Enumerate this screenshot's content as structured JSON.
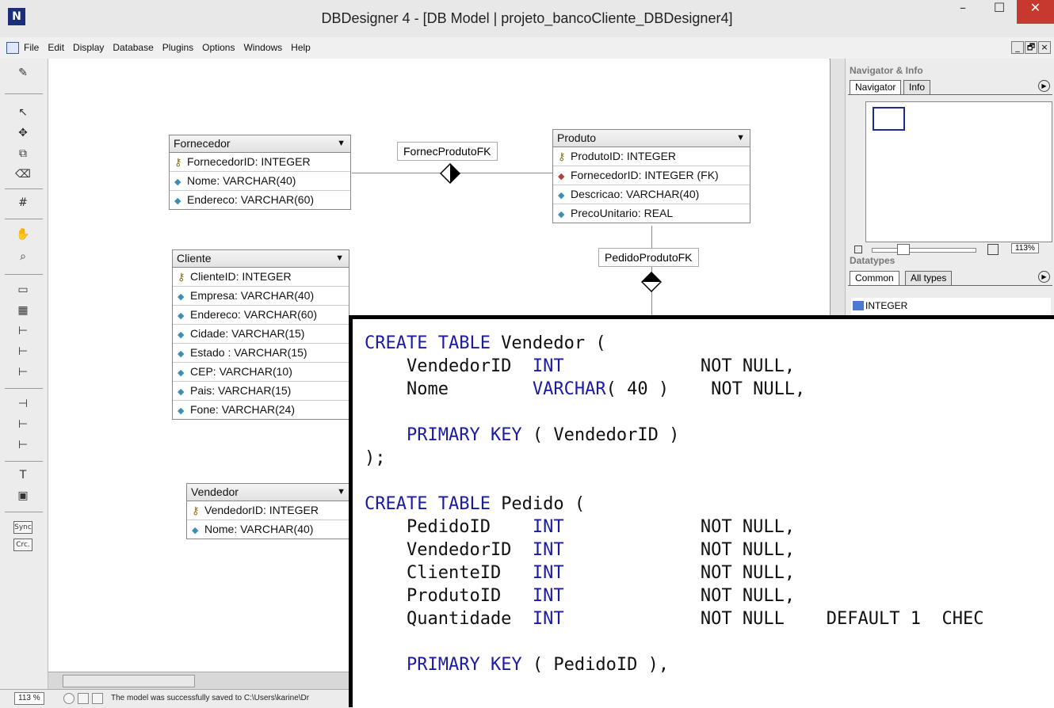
{
  "window": {
    "title": "DBDesigner 4 - [DB Model | projeto_bancoCliente_DBDesigner4]",
    "minimize": "–",
    "maximize": "☐",
    "close": "✕"
  },
  "menu": {
    "items": [
      "File",
      "Edit",
      "Display",
      "Database",
      "Plugins",
      "Options",
      "Windows",
      "Help"
    ],
    "mdi_buttons": [
      "_",
      "🗗",
      "×"
    ]
  },
  "toolbar": {
    "sync_label": "Sync",
    "crc_label": "Crc."
  },
  "diagram": {
    "tables": [
      {
        "name": "Fornecedor",
        "columns": [
          {
            "kind": "pk",
            "text": "FornecedorID: INTEGER"
          },
          {
            "kind": "attr",
            "text": "Nome: VARCHAR(40)"
          },
          {
            "kind": "attr",
            "text": "Endereco: VARCHAR(60)"
          }
        ]
      },
      {
        "name": "Produto",
        "columns": [
          {
            "kind": "pk",
            "text": "ProdutoID: INTEGER"
          },
          {
            "kind": "fk",
            "text": "FornecedorID: INTEGER (FK)"
          },
          {
            "kind": "attr",
            "text": "Descricao: VARCHAR(40)"
          },
          {
            "kind": "attr",
            "text": "PrecoUnitario: REAL"
          }
        ]
      },
      {
        "name": "Cliente",
        "columns": [
          {
            "kind": "pk",
            "text": "ClienteID: INTEGER"
          },
          {
            "kind": "attr",
            "text": "Empresa: VARCHAR(40)"
          },
          {
            "kind": "attr",
            "text": "Endereco: VARCHAR(60)"
          },
          {
            "kind": "attr",
            "text": "Cidade: VARCHAR(15)"
          },
          {
            "kind": "attr",
            "text": "Estado : VARCHAR(15)"
          },
          {
            "kind": "attr",
            "text": "CEP: VARCHAR(10)"
          },
          {
            "kind": "attr",
            "text": "Pais: VARCHAR(15)"
          },
          {
            "kind": "attr",
            "text": "Fone: VARCHAR(24)"
          }
        ]
      },
      {
        "name": "Vendedor",
        "columns": [
          {
            "kind": "pk",
            "text": "VendedorID: INTEGER"
          },
          {
            "kind": "attr",
            "text": "Nome: VARCHAR(40)"
          }
        ]
      }
    ],
    "relations": [
      "FornecProdutoFK",
      "PedidoProdutoFK"
    ]
  },
  "status": {
    "zoom": "113 %",
    "message": "The model was successfully saved to C:\\Users\\karine\\Dr"
  },
  "navigator": {
    "title": "Navigator & Info",
    "tabs": [
      "Navigator",
      "Info"
    ],
    "zoom": "113%"
  },
  "datatypes": {
    "title": "Datatypes",
    "tabs": [
      "Common",
      "All types"
    ],
    "first_item": "INTEGER"
  },
  "code": {
    "lines": [
      [
        {
          "t": "CREATE TABLE ",
          "k": 1
        },
        {
          "t": "Vendedor (",
          "k": 0
        }
      ],
      [
        {
          "t": "    VendedorID  ",
          "k": 0
        },
        {
          "t": "INT",
          "k": 1
        },
        {
          "t": "             NOT NULL,",
          "k": 0
        }
      ],
      [
        {
          "t": "    Nome        ",
          "k": 0
        },
        {
          "t": "VARCHAR",
          "k": 1
        },
        {
          "t": "( 40 )    NOT NULL,",
          "k": 0
        }
      ],
      [
        {
          "t": "",
          "k": 0
        }
      ],
      [
        {
          "t": "    ",
          "k": 0
        },
        {
          "t": "PRIMARY KEY",
          "k": 1
        },
        {
          "t": " ( VendedorID )",
          "k": 0
        }
      ],
      [
        {
          "t": ");",
          "k": 0
        }
      ],
      [
        {
          "t": "",
          "k": 0
        }
      ],
      [
        {
          "t": "CREATE TABLE ",
          "k": 1
        },
        {
          "t": "Pedido (",
          "k": 0
        }
      ],
      [
        {
          "t": "    PedidoID    ",
          "k": 0
        },
        {
          "t": "INT",
          "k": 1
        },
        {
          "t": "             NOT NULL,",
          "k": 0
        }
      ],
      [
        {
          "t": "    VendedorID  ",
          "k": 0
        },
        {
          "t": "INT",
          "k": 1
        },
        {
          "t": "             NOT NULL,",
          "k": 0
        }
      ],
      [
        {
          "t": "    ClienteID   ",
          "k": 0
        },
        {
          "t": "INT",
          "k": 1
        },
        {
          "t": "             NOT NULL,",
          "k": 0
        }
      ],
      [
        {
          "t": "    ProdutoID   ",
          "k": 0
        },
        {
          "t": "INT",
          "k": 1
        },
        {
          "t": "             NOT NULL,",
          "k": 0
        }
      ],
      [
        {
          "t": "    Quantidade  ",
          "k": 0
        },
        {
          "t": "INT",
          "k": 1
        },
        {
          "t": "             NOT NULL    DEFAULT 1  CHEC",
          "k": 0
        }
      ],
      [
        {
          "t": "",
          "k": 0
        }
      ],
      [
        {
          "t": "    ",
          "k": 0
        },
        {
          "t": "PRIMARY KEY",
          "k": 1
        },
        {
          "t": " ( PedidoID ),",
          "k": 0
        }
      ]
    ]
  }
}
